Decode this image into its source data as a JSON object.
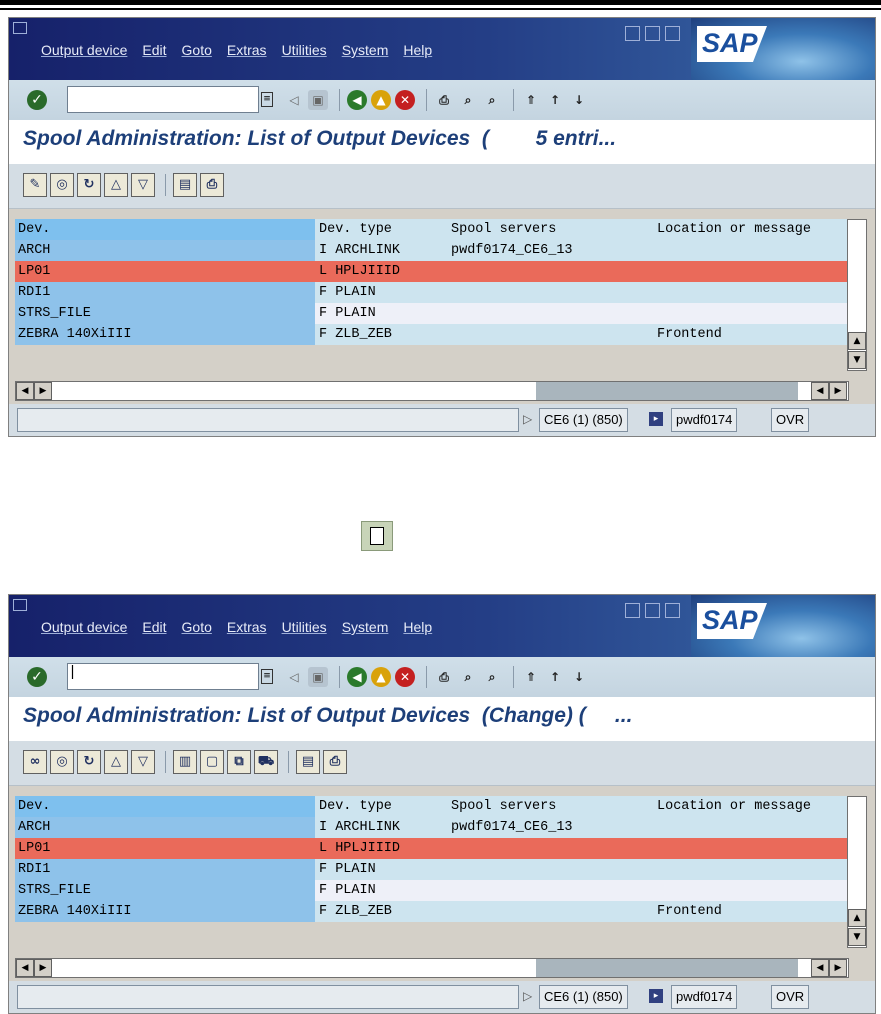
{
  "menu": [
    "Output device",
    "Edit",
    "Goto",
    "Extras",
    "Utilities",
    "System",
    "Help"
  ],
  "logo_text": "SAP",
  "columns": {
    "dev": "Dev.",
    "type": "Dev. type",
    "servers": "Spool servers",
    "location": "Location or message"
  },
  "rows": [
    {
      "dev": "ARCH",
      "type": "I ARCHLINK",
      "servers": "pwdf0174_CE6_13",
      "location": ""
    },
    {
      "dev": "LP01",
      "type": "L HPLJIIID",
      "servers": "",
      "location": ""
    },
    {
      "dev": "RDI1",
      "type": "F PLAIN",
      "servers": "",
      "location": ""
    },
    {
      "dev": "STRS_FILE",
      "type": "F PLAIN",
      "servers": "",
      "location": ""
    },
    {
      "dev": "ZEBRA 140XiIII",
      "type": "F ZLB_ZEB",
      "servers": "",
      "location": "Frontend"
    }
  ],
  "status": {
    "system": "CE6 (1) (850)",
    "server": "pwdf0174",
    "mode": "OVR"
  },
  "screen1": {
    "title": "Spool Administration: List of Output Devices  (        5 entri...",
    "command_value": ""
  },
  "screen2": {
    "title": "Spool Administration: List of Output Devices  (Change) (     ...",
    "command_value": "|"
  },
  "colors": {
    "header_row": "#7ec0ee",
    "selected_row": "#ea6a5a",
    "row_light": "#cde4ef",
    "row_lilac": "#eef0f8",
    "dev_col": "#8ec2ea"
  }
}
